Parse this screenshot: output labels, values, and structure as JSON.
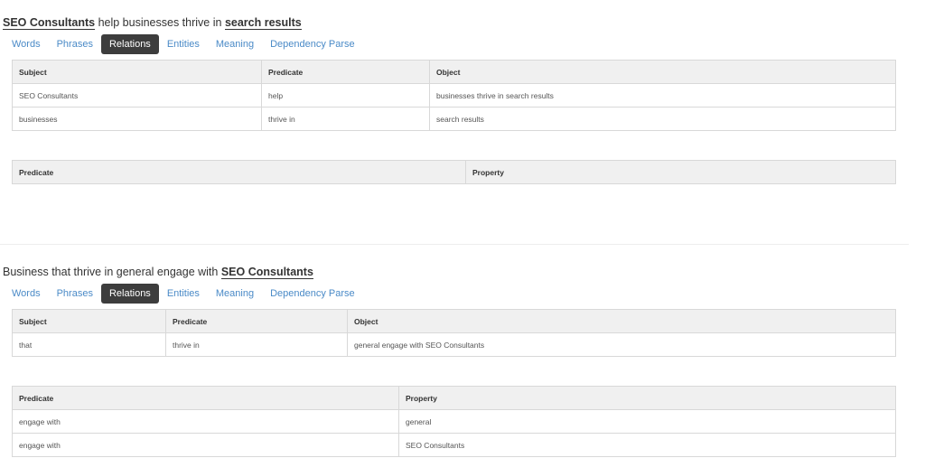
{
  "blocks": [
    {
      "sentence": [
        {
          "text": "SEO Consultants",
          "entity": true
        },
        {
          "text": " help businesses thrive in ",
          "entity": false
        },
        {
          "text": "search results",
          "entity": true
        }
      ],
      "tabs": [
        "Words",
        "Phrases",
        "Relations",
        "Entities",
        "Meaning",
        "Dependency Parse"
      ],
      "active_tab": "Relations",
      "relations": {
        "headers": [
          "Subject",
          "Predicate",
          "Object"
        ],
        "rows": [
          [
            "SEO Consultants",
            "help",
            "businesses thrive in search results"
          ],
          [
            "businesses",
            "thrive in",
            "search results"
          ]
        ]
      },
      "properties": {
        "headers": [
          "Predicate",
          "Property"
        ],
        "rows": []
      }
    },
    {
      "sentence": [
        {
          "text": "Business that thrive in general engage with ",
          "entity": false
        },
        {
          "text": "SEO Consultants",
          "entity": true
        }
      ],
      "tabs": [
        "Words",
        "Phrases",
        "Relations",
        "Entities",
        "Meaning",
        "Dependency Parse"
      ],
      "active_tab": "Relations",
      "relations": {
        "headers": [
          "Subject",
          "Predicate",
          "Object"
        ],
        "rows": [
          [
            "that",
            "thrive in",
            "general engage with SEO Consultants"
          ]
        ]
      },
      "properties": {
        "headers": [
          "Predicate",
          "Property"
        ],
        "rows": [
          [
            "engage with",
            "general"
          ],
          [
            "engage with",
            "SEO Consultants"
          ]
        ]
      }
    }
  ],
  "colors": {
    "active_tab_bg": "#3d3d3d",
    "tab_link": "#4a8ac7",
    "table_header_bg": "#f0f0f0",
    "border": "#d8d8d8"
  }
}
